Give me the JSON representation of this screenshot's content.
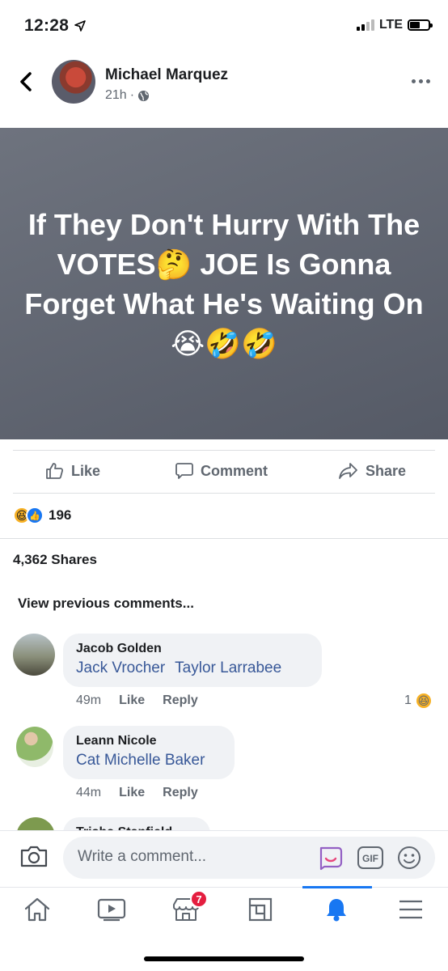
{
  "status": {
    "time": "12:28",
    "network": "LTE"
  },
  "post": {
    "author": "Michael Marquez",
    "time": "21h",
    "text": "If They Don't Hurry With The VOTES🤔 JOE Is Gonna Forget What He's Waiting On😭🤣🤣"
  },
  "actions": {
    "like": "Like",
    "comment": "Comment",
    "share": "Share"
  },
  "reactions": {
    "count": "196",
    "icons": [
      "haha-emoji-icon",
      "like-badge-icon"
    ]
  },
  "shares": "4,362 Shares",
  "view_previous": "View previous comments...",
  "comments": [
    {
      "name": "Jacob Golden",
      "tags": [
        "Jack Vrocher",
        "Taylor Larrabee"
      ],
      "time": "49m",
      "like": "Like",
      "reply": "Reply",
      "reaction_count": "1"
    },
    {
      "name": "Leann Nicole",
      "tags": [
        "Cat Michelle Baker"
      ],
      "time": "44m",
      "like": "Like",
      "reply": "Reply"
    },
    {
      "name": "Trisha Stanfield"
    }
  ],
  "composer": {
    "placeholder": "Write a comment..."
  },
  "nav": {
    "marketplace_badge": "7",
    "active": "notifications"
  },
  "colors": {
    "accent": "#1877f2",
    "link": "#385898",
    "badge": "#e41e3f"
  }
}
